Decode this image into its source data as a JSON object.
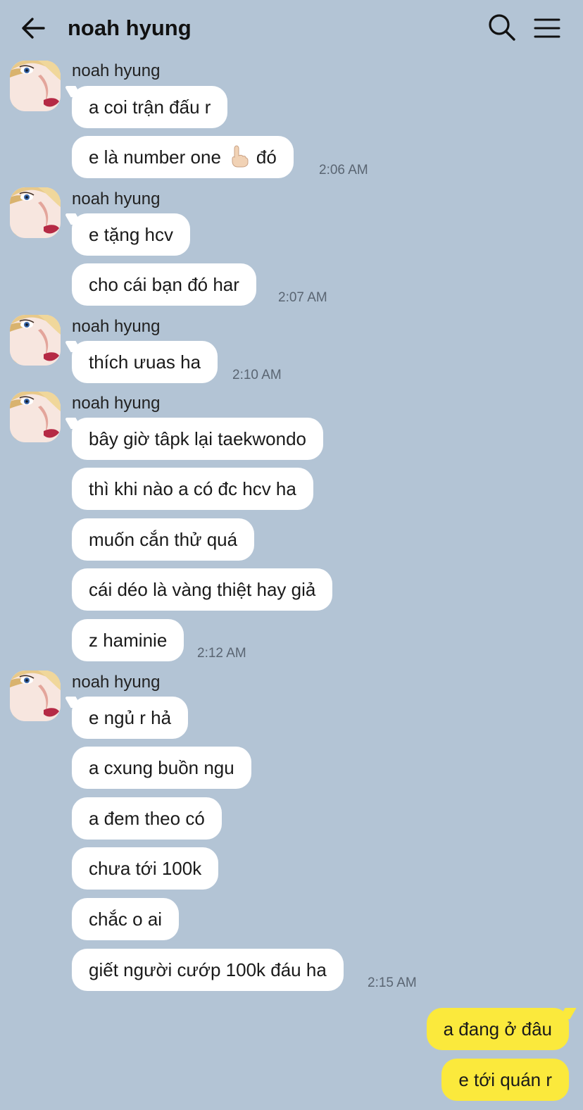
{
  "header": {
    "title": "noah hyung",
    "back_icon": "arrow-left-icon",
    "search_icon": "search-icon",
    "menu_icon": "hamburger-menu-icon"
  },
  "groups": [
    {
      "sender": "noah hyung",
      "messages": [
        "a coi trận đấu r",
        "e là number one",
        "đó"
      ],
      "time": "2:06 AM"
    },
    {
      "sender": "noah hyung",
      "messages": [
        "e tặng hcv",
        "cho cái bạn đó har"
      ],
      "time": "2:07 AM"
    },
    {
      "sender": "noah hyung",
      "messages": [
        "thích ưuas ha"
      ],
      "time": "2:10 AM"
    },
    {
      "sender": "noah hyung",
      "messages": [
        "bây giờ tâpk lại taekwondo",
        "thì khi nào a có đc hcv ha",
        "muốn cắn thử quá",
        "cái déo là vàng thiệt hay giả",
        "z haminie"
      ],
      "time": "2:12 AM"
    },
    {
      "sender": "noah hyung",
      "messages": [
        "e ngủ r hả",
        "a cxung buồn ngu",
        "a đem theo có",
        "chưa tới 100k",
        "chắc o ai",
        "giết người cướp 100k đáu ha"
      ],
      "time": "2:15 AM"
    }
  ],
  "outgoing": {
    "messages": [
      "a đang ở đâu",
      "e tới quán r"
    ]
  },
  "colors": {
    "background": "#b3c4d5",
    "incoming_bubble": "#ffffff",
    "outgoing_bubble": "#fbe93c"
  }
}
